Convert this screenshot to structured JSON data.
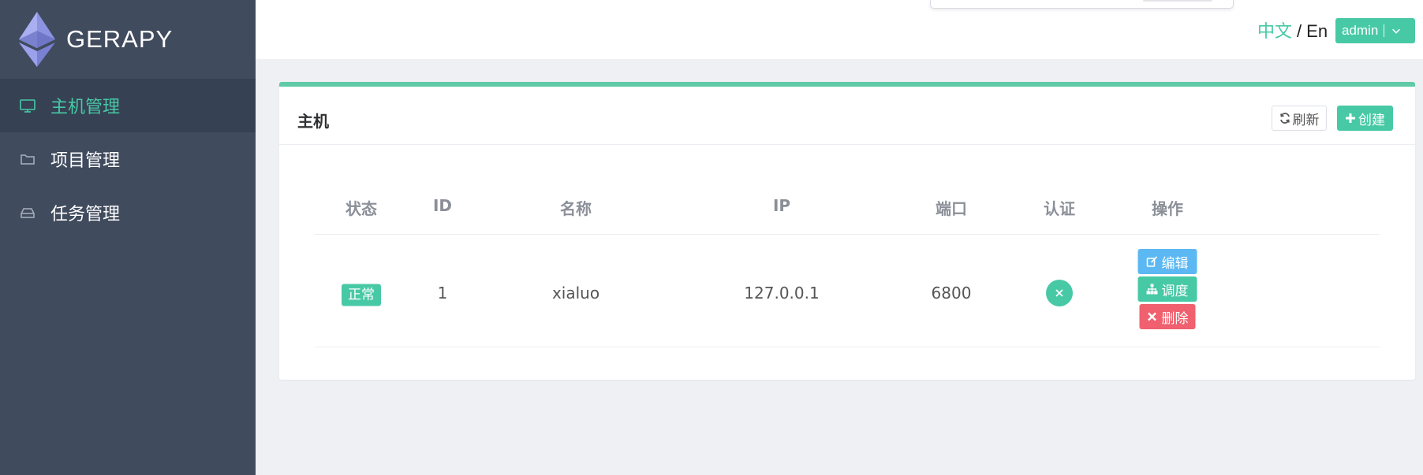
{
  "app": {
    "logo_text": "GERAPY"
  },
  "sidebar": {
    "items": [
      {
        "label": "主机管理",
        "icon": "monitor-icon",
        "active": true
      },
      {
        "label": "项目管理",
        "icon": "folder-icon",
        "active": false
      },
      {
        "label": "任务管理",
        "icon": "inbox-icon",
        "active": false
      }
    ]
  },
  "header": {
    "lang_zh": "中文",
    "lang_sep": "/",
    "lang_en": "En",
    "user": "admin"
  },
  "panel": {
    "title": "主机",
    "refresh_label": "刷新",
    "create_label": "创建"
  },
  "table": {
    "columns": [
      "状态",
      "ID",
      "名称",
      "IP",
      "端口",
      "认证",
      "操作"
    ],
    "rows": [
      {
        "status": "正常",
        "id": "1",
        "name": "xialuo",
        "ip": "127.0.0.1",
        "port": "6800",
        "auth": "x-icon",
        "actions": {
          "edit": "编辑",
          "schedule": "调度",
          "delete": "删除"
        }
      }
    ]
  },
  "colors": {
    "accent": "#48c9a6",
    "sidebar_bg": "#404b5e",
    "sidebar_active_bg": "#364153",
    "edit": "#5cb8f2",
    "delete": "#f0606e"
  }
}
